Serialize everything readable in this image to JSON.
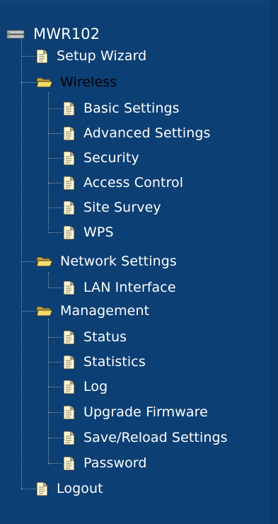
{
  "tree": {
    "root": {
      "label": "MWR102",
      "icon": "network-device-icon"
    },
    "setup_wizard": {
      "label": "Setup Wizard",
      "icon": "document-icon"
    },
    "wireless": {
      "label": "Wireless",
      "icon": "folder-open-icon",
      "items": [
        {
          "label": "Basic Settings",
          "icon": "document-icon"
        },
        {
          "label": "Advanced Settings",
          "icon": "document-icon"
        },
        {
          "label": "Security",
          "icon": "document-icon"
        },
        {
          "label": "Access Control",
          "icon": "document-icon"
        },
        {
          "label": "Site Survey",
          "icon": "document-icon"
        },
        {
          "label": "WPS",
          "icon": "document-icon"
        }
      ]
    },
    "network_settings": {
      "label": "Network Settings",
      "icon": "folder-open-icon",
      "items": [
        {
          "label": "LAN Interface",
          "icon": "document-icon"
        }
      ]
    },
    "management": {
      "label": "Management",
      "icon": "folder-open-icon",
      "items": [
        {
          "label": "Status",
          "icon": "document-icon"
        },
        {
          "label": "Statistics",
          "icon": "document-icon"
        },
        {
          "label": "Log",
          "icon": "document-icon"
        },
        {
          "label": "Upgrade Firmware",
          "icon": "document-icon"
        },
        {
          "label": "Save/Reload Settings",
          "icon": "document-icon"
        },
        {
          "label": "Password",
          "icon": "document-icon"
        }
      ]
    },
    "logout": {
      "label": "Logout",
      "icon": "document-icon"
    }
  },
  "colors": {
    "background": "#0c3f74",
    "text": "#ffffff",
    "selected_text": "#000000",
    "tree_lines": "#8d9fb3"
  }
}
